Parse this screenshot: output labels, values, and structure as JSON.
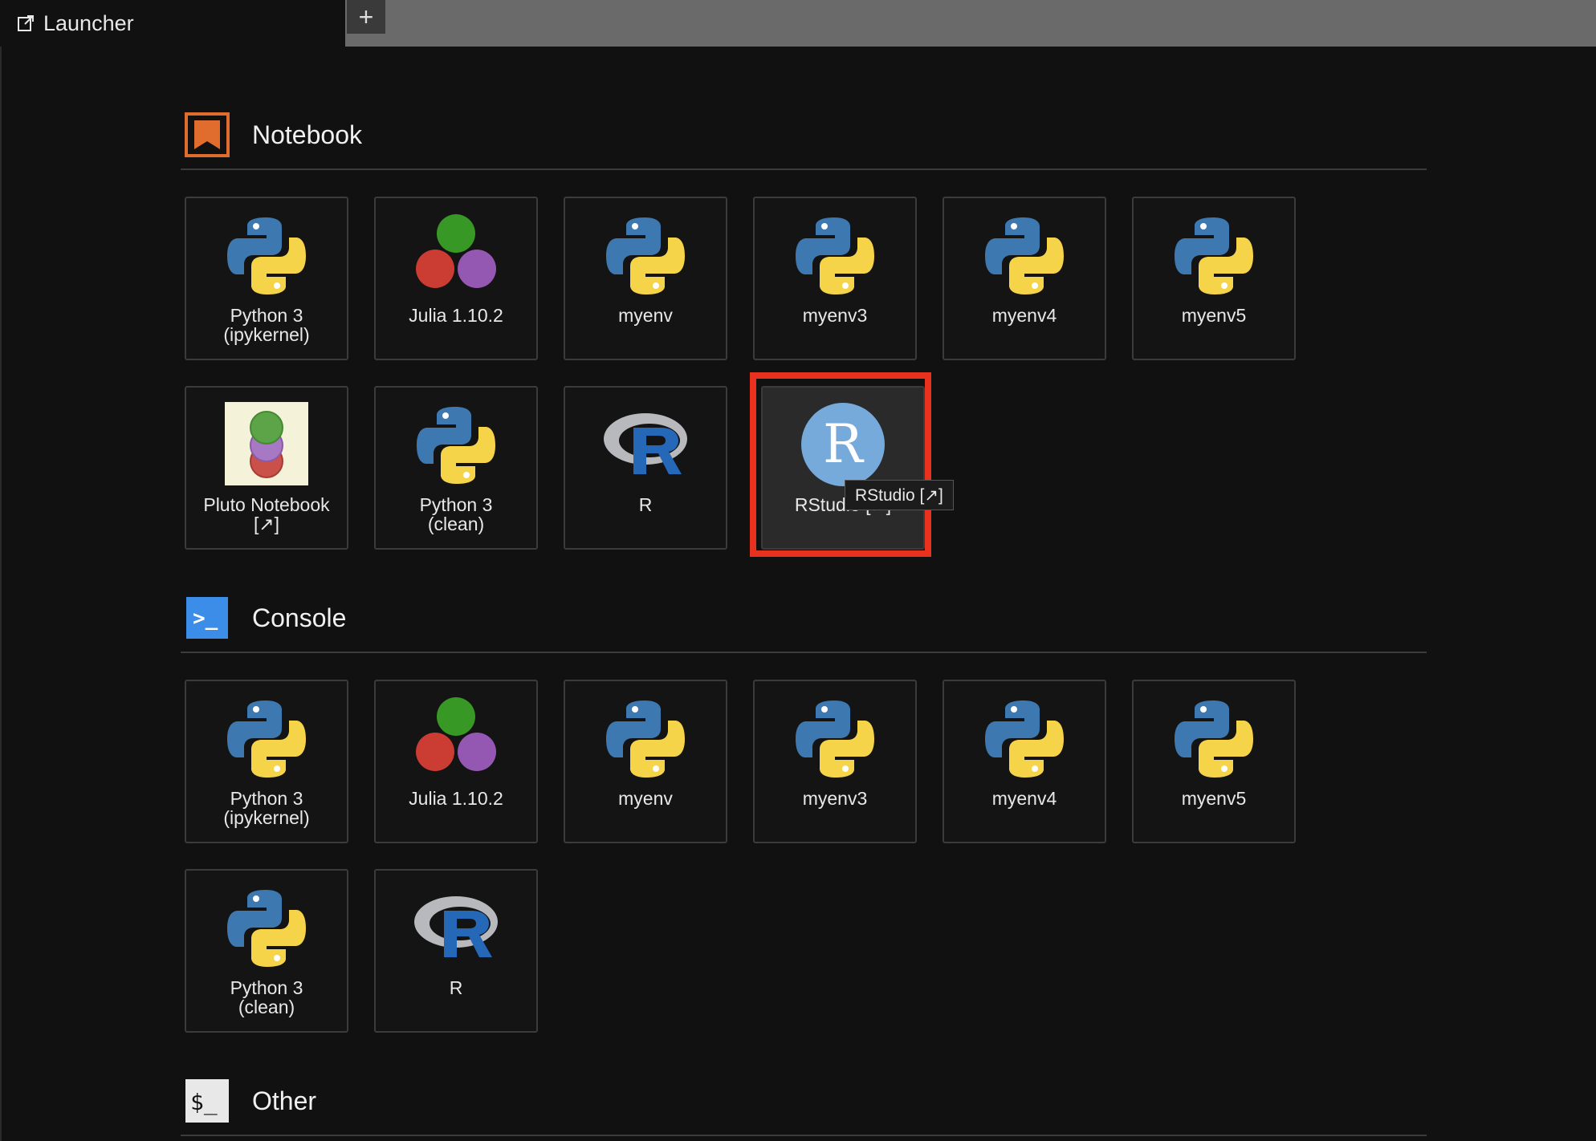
{
  "tab": {
    "label": "Launcher",
    "new_tab_symbol": "+"
  },
  "sections": {
    "notebook": {
      "title": "Notebook",
      "items": [
        {
          "label": "Python 3\n(ipykernel)",
          "icon": "python-logo-icon"
        },
        {
          "label": "Julia 1.10.2",
          "icon": "julia-logo-icon"
        },
        {
          "label": "myenv",
          "icon": "python-logo-icon"
        },
        {
          "label": "myenv3",
          "icon": "python-logo-icon"
        },
        {
          "label": "myenv4",
          "icon": "python-logo-icon"
        },
        {
          "label": "myenv5",
          "icon": "python-logo-icon"
        },
        {
          "label": "Pluto Notebook\n[↗]",
          "icon": "pluto-logo-icon"
        },
        {
          "label": "Python 3\n(clean)",
          "icon": "python-logo-icon"
        },
        {
          "label": "R",
          "icon": "r-logo-icon"
        },
        {
          "label": "RStudio [↗]",
          "icon": "rstudio-logo-icon"
        }
      ]
    },
    "console": {
      "title": "Console",
      "items": [
        {
          "label": "Python 3\n(ipykernel)",
          "icon": "python-logo-icon"
        },
        {
          "label": "Julia 1.10.2",
          "icon": "julia-logo-icon"
        },
        {
          "label": "myenv",
          "icon": "python-logo-icon"
        },
        {
          "label": "myenv3",
          "icon": "python-logo-icon"
        },
        {
          "label": "myenv4",
          "icon": "python-logo-icon"
        },
        {
          "label": "myenv5",
          "icon": "python-logo-icon"
        },
        {
          "label": "Python 3\n(clean)",
          "icon": "python-logo-icon"
        },
        {
          "label": "R",
          "icon": "r-logo-icon"
        }
      ]
    },
    "other": {
      "title": "Other",
      "icon_text": "$_"
    }
  },
  "tooltip": {
    "text": "RStudio [↗]"
  },
  "console_icon_text": ">_",
  "colors": {
    "notebook_accent": "#e06c2e",
    "console_accent": "#3b8de8",
    "highlight": "#e8321f",
    "python_blue": "#3d78b0",
    "python_yellow": "#f6d44a",
    "julia_green": "#389826",
    "julia_red": "#cb3c33",
    "julia_purple": "#9558b2",
    "rstudio_blue": "#75aadb"
  }
}
